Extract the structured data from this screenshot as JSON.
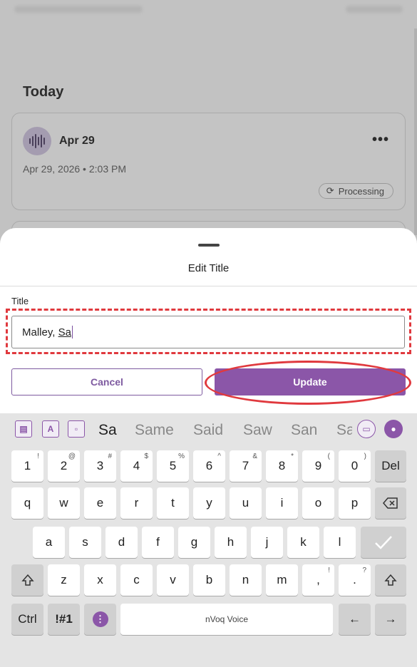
{
  "background": {
    "section_title": "Today",
    "recording": {
      "title": "Apr 29",
      "date": "Apr 29, 2026 • 2:03 PM",
      "status": "Processing"
    }
  },
  "sheet": {
    "title": "Edit Title",
    "field_label": "Title",
    "input_value_committed": "Malley, ",
    "input_value_composing": "Sa",
    "cancel_label": "Cancel",
    "update_label": "Update"
  },
  "keyboard": {
    "suggestions": [
      "Sa",
      "Same",
      "Said",
      "Saw",
      "San",
      "Sa"
    ],
    "row_numbers": [
      {
        "main": "1",
        "alt": "!"
      },
      {
        "main": "2",
        "alt": "@"
      },
      {
        "main": "3",
        "alt": "#"
      },
      {
        "main": "4",
        "alt": "$"
      },
      {
        "main": "5",
        "alt": "%"
      },
      {
        "main": "6",
        "alt": "^"
      },
      {
        "main": "7",
        "alt": "&"
      },
      {
        "main": "8",
        "alt": "*"
      },
      {
        "main": "9",
        "alt": "("
      },
      {
        "main": "0",
        "alt": ")"
      }
    ],
    "del_label": "Del",
    "row_q": [
      "q",
      "w",
      "e",
      "r",
      "t",
      "y",
      "u",
      "i",
      "o",
      "p"
    ],
    "row_a": [
      "a",
      "s",
      "d",
      "f",
      "g",
      "h",
      "j",
      "k",
      "l"
    ],
    "row_z": [
      "z",
      "x",
      "c",
      "v",
      "b",
      "n",
      "m"
    ],
    "comma": {
      "main": ",",
      "alt": "!"
    },
    "period": {
      "main": ".",
      "alt": "?"
    },
    "ctrl_label": "Ctrl",
    "symbols_label": "!#1",
    "space_label": "nVoq Voice",
    "left_arrow": "←",
    "right_arrow": "→"
  },
  "colors": {
    "accent": "#8b56a8",
    "highlight": "#e0393e"
  }
}
